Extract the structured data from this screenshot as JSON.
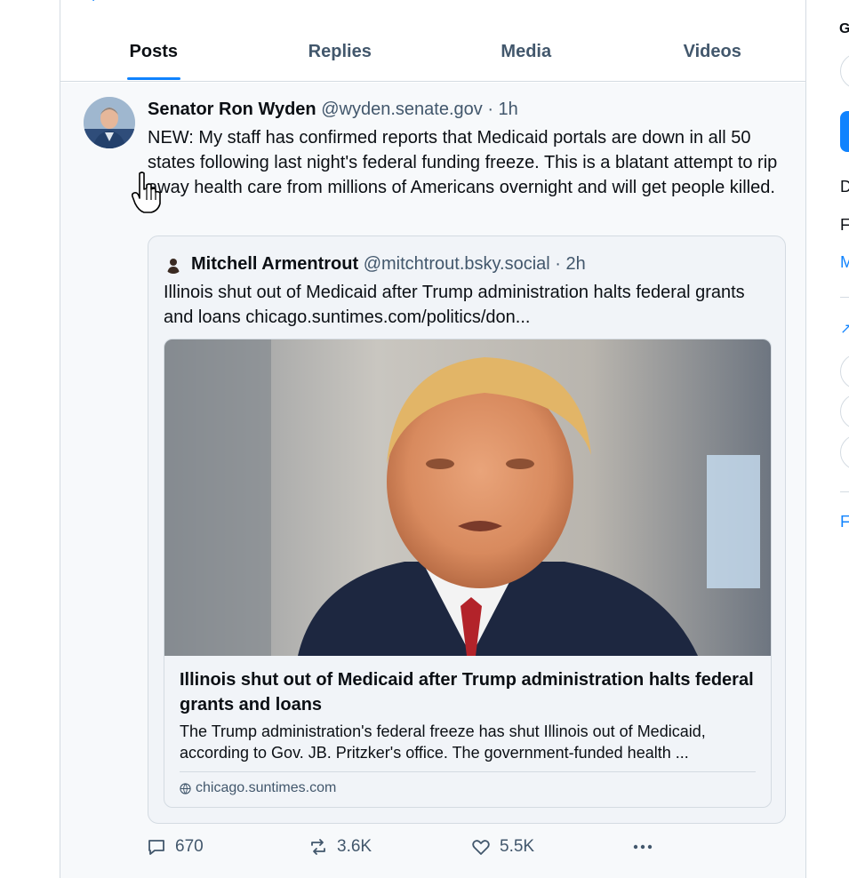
{
  "tabs": [
    {
      "label": "Posts",
      "active": true
    },
    {
      "label": "Replies",
      "active": false
    },
    {
      "label": "Media",
      "active": false
    },
    {
      "label": "Videos",
      "active": false
    }
  ],
  "post": {
    "author_name": "Senator Ron Wyden",
    "author_handle": "@wyden.senate.gov",
    "time": "· 1h",
    "text": "NEW: My staff has confirmed reports that Medicaid portals are down in all 50 states following last night's federal funding freeze. This is a blatant attempt to rip away health care from millions of Americans overnight and will get people killed."
  },
  "quote": {
    "author_name": "Mitchell Armentrout",
    "author_handle": "@mitchtrout.bsky.social",
    "time": "· 2h",
    "text": "Illinois shut out of Medicaid after Trump administration halts federal grants and loans chicago.suntimes.com/politics/don...",
    "link_card": {
      "title": "Illinois shut out of Medicaid after Trump administration halts federal grants and loans",
      "description": "The Trump administration's federal freeze has shut Illinois out of Medicaid, according to Gov. JB. Pritzker's office. The government-funded health ...",
      "domain": "chicago.suntimes.com"
    }
  },
  "actions": {
    "reply_count": "670",
    "repost_count": "3.6K",
    "like_count": "5.5K",
    "more_icon": "ellipsis-icon"
  },
  "right_column": {
    "fragment_1": "G",
    "fragment_2": "D",
    "fragment_3": "F",
    "fragment_4": "M",
    "fragment_5": "F"
  },
  "colors": {
    "accent": "#1083fe",
    "muted_text": "#42576c",
    "border": "#d4dbe2",
    "post_bg": "#f7f9fb"
  }
}
